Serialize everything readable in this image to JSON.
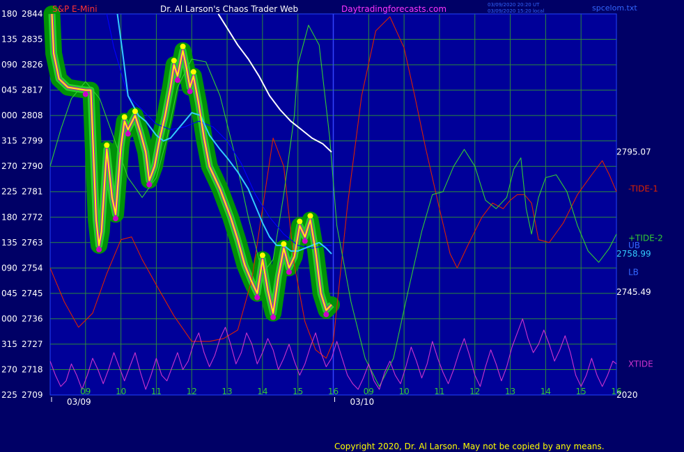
{
  "header": {
    "instrument": "S&P E-Mini",
    "site": "Dr. Al Larson's Chaos Trader Web",
    "url": "Daytradingforecasts.com",
    "timestamp_ut": "03/09/2020 20:20 UT",
    "timestamp_local": "03/09/2020 15:20 local",
    "file": "spcelom.txt"
  },
  "copyright": "Copyright 2020, Dr. Al Larson. May not be copied by any means.",
  "colors": {
    "background": "#000066",
    "plot_background": "#000099",
    "grid": "#2d8a3c",
    "price": "#ffff00",
    "cyan": "#33ccff",
    "tide1": "#dd2200",
    "tide2": "#33cc33",
    "xtide": "#cc33cc",
    "white_line": "#ffffff",
    "dark_blue_line": "#0000ff",
    "band_green": "#009900",
    "band_magenta": "#cc00cc"
  },
  "chart_data": {
    "type": "line",
    "title": "S&P E-Mini",
    "ylim": [
      2709,
      2844
    ],
    "xlim": [
      8.0,
      24.0
    ],
    "y_ticks": [
      {
        "angle": "180",
        "price": "2844"
      },
      {
        "angle": "135",
        "price": "2835"
      },
      {
        "angle": "090",
        "price": "2826"
      },
      {
        "angle": "045",
        "price": "2817"
      },
      {
        "angle": "000",
        "price": "2808"
      },
      {
        "angle": "315",
        "price": "2799"
      },
      {
        "angle": "270",
        "price": "2790"
      },
      {
        "angle": "225",
        "price": "2781"
      },
      {
        "angle": "180",
        "price": "2772"
      },
      {
        "angle": "135",
        "price": "2763"
      },
      {
        "angle": "090",
        "price": "2754"
      },
      {
        "angle": "045",
        "price": "2745"
      },
      {
        "angle": "000",
        "price": "2736"
      },
      {
        "angle": "315",
        "price": "2727"
      },
      {
        "angle": "270",
        "price": "2718"
      },
      {
        "angle": "225",
        "price": "2709"
      }
    ],
    "x_ticks": [
      {
        "x": 9,
        "label": "09"
      },
      {
        "x": 10,
        "label": "10"
      },
      {
        "x": 11,
        "label": "11"
      },
      {
        "x": 12,
        "label": "12"
      },
      {
        "x": 13,
        "label": "13"
      },
      {
        "x": 14,
        "label": "14"
      },
      {
        "x": 15,
        "label": "15"
      },
      {
        "x": 16,
        "label": "16"
      },
      {
        "x": 17,
        "label": "09"
      },
      {
        "x": 18,
        "label": "10"
      },
      {
        "x": 19,
        "label": "11"
      },
      {
        "x": 20,
        "label": "12"
      },
      {
        "x": 21,
        "label": "13"
      },
      {
        "x": 22,
        "label": "14"
      },
      {
        "x": 23,
        "label": "15"
      },
      {
        "x": 24,
        "label": "16"
      }
    ],
    "dates": [
      {
        "x": 8.0,
        "label": "03/09"
      },
      {
        "x": 16.0,
        "label": "03/10"
      }
    ],
    "day_divider_x": 16.0,
    "right_labels": [
      {
        "text": "2795.07",
        "y": 2795.07,
        "color": "#ffffff"
      },
      {
        "text": "-TIDE-1",
        "y": 2782.0,
        "color": "#dd2200"
      },
      {
        "text": "+TIDE-2",
        "y": 2764.5,
        "color": "#33cc33"
      },
      {
        "text": "UB",
        "y": 2762.0,
        "color": "#3366ff"
      },
      {
        "text": "2758.99",
        "y": 2758.99,
        "color": "#33ccff"
      },
      {
        "text": "LB",
        "y": 2752.5,
        "color": "#3366ff"
      },
      {
        "text": "2745.49",
        "y": 2745.49,
        "color": "#ffffff"
      },
      {
        "text": "XTIDE",
        "y": 2720.0,
        "color": "#cc33cc"
      },
      {
        "text": "2020",
        "y": 2709.0,
        "color": "#ffffff"
      }
    ],
    "series": [
      {
        "key": "price_yellow",
        "color": "#ffff00",
        "x": [
          8.05,
          8.1,
          8.25,
          8.5,
          8.75,
          9.0,
          9.15,
          9.3,
          9.38,
          9.45,
          9.6,
          9.75,
          9.85,
          10.0,
          10.1,
          10.2,
          10.4,
          10.55,
          10.7,
          10.8,
          10.95,
          11.1,
          11.25,
          11.4,
          11.5,
          11.6,
          11.75,
          11.85,
          11.95,
          12.05,
          12.2,
          12.35,
          12.5,
          12.65,
          12.8,
          12.95,
          13.1,
          13.3,
          13.5,
          13.7,
          13.85,
          14.0,
          14.15,
          14.3,
          14.45,
          14.6,
          14.75,
          14.9,
          15.05,
          15.2,
          15.35,
          15.5,
          15.65,
          15.8,
          15.95
        ],
        "y": [
          2844.0,
          2830.0,
          2821.0,
          2818.0,
          2817.5,
          2817.0,
          2817.0,
          2771.0,
          2762.0,
          2767.0,
          2796.0,
          2779.0,
          2773.0,
          2797.0,
          2806.0,
          2803.0,
          2808.0,
          2802.0,
          2795.0,
          2785.0,
          2790.0,
          2800.0,
          2808.0,
          2818.0,
          2826.0,
          2822.0,
          2831.0,
          2825.0,
          2818.0,
          2822.0,
          2812.0,
          2800.0,
          2790.0,
          2786.0,
          2782.0,
          2777.0,
          2772.0,
          2764.0,
          2755.0,
          2749.0,
          2745.0,
          2757.0,
          2746.0,
          2738.0,
          2751.0,
          2761.0,
          2754.0,
          2758.0,
          2769.0,
          2765.0,
          2771.0,
          2760.0,
          2745.0,
          2739.0,
          2741.0
        ]
      },
      {
        "key": "cyan_line",
        "color": "#33ccff",
        "x": [
          9.9,
          10.05,
          10.2,
          10.5,
          10.7,
          11.0,
          11.2,
          11.4,
          11.6,
          11.8,
          12.0,
          12.25,
          12.5,
          12.8,
          13.0,
          13.3,
          13.6,
          13.8,
          14.0,
          14.2,
          14.4,
          14.6,
          14.8,
          15.0,
          15.2,
          15.4,
          15.6,
          15.8,
          15.95
        ],
        "y": [
          2844.0,
          2830.0,
          2815.0,
          2808.0,
          2806.0,
          2801.0,
          2799.0,
          2800.0,
          2803.0,
          2806.0,
          2809.0,
          2808.0,
          2801.0,
          2796.0,
          2793.0,
          2788.0,
          2782.0,
          2776.0,
          2770.0,
          2765.0,
          2762.0,
          2762.0,
          2760.0,
          2760.0,
          2761.0,
          2762.0,
          2763.0,
          2761.0,
          2758.99
        ]
      },
      {
        "key": "dark_blue_line",
        "color": "#0000ff",
        "x": [
          9.6,
          9.8,
          10.2,
          10.6,
          11.0,
          11.4,
          11.8,
          12.2,
          12.6,
          13.0,
          13.4,
          13.8,
          14.2,
          14.6,
          15.0,
          15.4,
          15.8,
          15.95
        ],
        "y": [
          2844.0,
          2832.0,
          2815.0,
          2810.0,
          2805.0,
          2803.0,
          2804.0,
          2806.0,
          2804.0,
          2799.0,
          2791.0,
          2780.0,
          2772.0,
          2766.0,
          2762.0,
          2761.0,
          2762.0,
          2762.0
        ]
      },
      {
        "key": "white_line",
        "color": "#ffffff",
        "x": [
          12.75,
          13.0,
          13.3,
          13.6,
          13.9,
          14.2,
          14.5,
          14.8,
          15.1,
          15.4,
          15.7,
          15.95
        ],
        "y": [
          2844.0,
          2839.0,
          2833.0,
          2828.0,
          2822.0,
          2815.0,
          2810.0,
          2806.0,
          2803.0,
          2800.0,
          2798.0,
          2795.07
        ]
      },
      {
        "key": "tide1",
        "color": "#dd2200",
        "x": [
          8.0,
          8.4,
          8.8,
          9.2,
          9.6,
          10.0,
          10.3,
          10.6,
          11.0,
          11.5,
          12.0,
          12.5,
          12.9,
          13.3,
          13.7,
          14.0,
          14.3,
          14.6,
          14.9,
          15.2,
          15.5,
          15.8,
          16.0,
          16.4,
          16.8,
          17.2,
          17.6,
          18.0,
          18.3,
          18.6,
          19.0,
          19.3,
          19.5,
          19.8,
          20.2,
          20.5,
          20.8,
          21.0,
          21.2,
          21.4,
          21.6,
          21.8,
          22.1,
          22.5,
          22.9,
          23.3,
          23.6,
          23.8,
          24.0
        ],
        "y": [
          2754.0,
          2742.0,
          2733.0,
          2738.0,
          2752.0,
          2764.0,
          2765.0,
          2757.0,
          2748.0,
          2737.0,
          2728.0,
          2728.0,
          2729.0,
          2732.0,
          2750.0,
          2775.0,
          2800.0,
          2790.0,
          2755.0,
          2735.0,
          2725.0,
          2722.0,
          2728.0,
          2776.0,
          2815.0,
          2838.0,
          2843.0,
          2832.0,
          2815.0,
          2797.0,
          2775.0,
          2759.0,
          2754.0,
          2762.0,
          2772.0,
          2777.0,
          2775.0,
          2778.0,
          2780.0,
          2780.0,
          2777.0,
          2764.0,
          2763.0,
          2770.0,
          2780.0,
          2787.0,
          2792.0,
          2787.0,
          2781.0
        ]
      },
      {
        "key": "tide2",
        "color": "#33cc33",
        "x": [
          8.0,
          8.3,
          8.6,
          9.0,
          9.4,
          9.8,
          10.2,
          10.6,
          11.0,
          11.3,
          11.6,
          12.0,
          12.4,
          12.8,
          13.2,
          13.6,
          14.0,
          14.3,
          14.6,
          14.9,
          15.0,
          15.3,
          15.6,
          15.9,
          16.1,
          16.5,
          16.9,
          17.3,
          17.7,
          18.1,
          18.5,
          18.8,
          19.1,
          19.4,
          19.7,
          20.0,
          20.3,
          20.6,
          20.9,
          21.1,
          21.3,
          21.45,
          21.6,
          21.8,
          22.0,
          22.3,
          22.6,
          22.9,
          23.2,
          23.5,
          23.8,
          24.0
        ],
        "y": [
          2790.0,
          2803.0,
          2814.0,
          2820.0,
          2814.0,
          2800.0,
          2786.0,
          2779.0,
          2786.0,
          2800.0,
          2818.0,
          2828.0,
          2827.0,
          2815.0,
          2795.0,
          2772.0,
          2752.0,
          2757.0,
          2780.0,
          2808.0,
          2826.0,
          2840.0,
          2833.0,
          2800.0,
          2769.0,
          2742.0,
          2722.0,
          2712.0,
          2722.0,
          2745.0,
          2767.0,
          2780.0,
          2781.0,
          2790.0,
          2796.0,
          2790.0,
          2778.0,
          2775.0,
          2779.0,
          2789.0,
          2793.0,
          2775.0,
          2766.0,
          2779.0,
          2786.0,
          2787.0,
          2781.0,
          2769.0,
          2760.0,
          2756.0,
          2761.0,
          2766.0
        ]
      },
      {
        "key": "xtide",
        "color": "#cc33cc",
        "x": [
          8.0,
          8.15,
          8.3,
          8.45,
          8.6,
          8.75,
          8.9,
          9.05,
          9.2,
          9.35,
          9.5,
          9.65,
          9.8,
          9.95,
          10.1,
          10.25,
          10.4,
          10.55,
          10.7,
          10.85,
          11.0,
          11.15,
          11.3,
          11.45,
          11.6,
          11.75,
          11.9,
          12.05,
          12.2,
          12.35,
          12.5,
          12.65,
          12.8,
          12.95,
          13.1,
          13.25,
          13.4,
          13.55,
          13.7,
          13.85,
          14.0,
          14.15,
          14.3,
          14.45,
          14.6,
          14.75,
          14.9,
          15.05,
          15.2,
          15.35,
          15.5,
          15.65,
          15.8,
          15.95,
          16.1,
          16.25,
          16.4,
          16.55,
          16.7,
          16.85,
          17.0,
          17.15,
          17.3,
          17.45,
          17.6,
          17.75,
          17.9,
          18.05,
          18.2,
          18.35,
          18.5,
          18.65,
          18.8,
          18.95,
          19.1,
          19.25,
          19.4,
          19.55,
          19.7,
          19.85,
          20.0,
          20.15,
          20.3,
          20.45,
          20.6,
          20.75,
          20.9,
          21.05,
          21.2,
          21.35,
          21.5,
          21.65,
          21.8,
          21.95,
          22.1,
          22.25,
          22.4,
          22.55,
          22.7,
          22.85,
          23.0,
          23.15,
          23.3,
          23.45,
          23.6,
          23.75,
          23.9,
          24.0
        ],
        "y": [
          2721.0,
          2716.0,
          2712.0,
          2714.0,
          2720.0,
          2716.0,
          2711.0,
          2716.0,
          2722.0,
          2718.0,
          2713.0,
          2718.0,
          2724.0,
          2719.0,
          2714.0,
          2719.0,
          2724.0,
          2717.0,
          2711.0,
          2716.0,
          2722.0,
          2716.0,
          2714.0,
          2719.0,
          2724.0,
          2718.0,
          2721.0,
          2727.0,
          2731.0,
          2724.0,
          2719.0,
          2723.0,
          2729.0,
          2733.0,
          2727.0,
          2720.0,
          2724.0,
          2731.0,
          2727.0,
          2720.0,
          2724.0,
          2729.0,
          2725.0,
          2718.0,
          2722.0,
          2727.0,
          2721.0,
          2716.0,
          2720.0,
          2726.0,
          2731.0,
          2724.0,
          2719.0,
          2722.0,
          2728.0,
          2722.0,
          2716.0,
          2713.0,
          2711.0,
          2715.0,
          2720.0,
          2714.0,
          2711.0,
          2717.0,
          2721.0,
          2716.0,
          2713.0,
          2719.0,
          2726.0,
          2721.0,
          2715.0,
          2720.0,
          2728.0,
          2722.0,
          2717.0,
          2713.0,
          2718.0,
          2724.0,
          2729.0,
          2723.0,
          2716.0,
          2712.0,
          2719.0,
          2725.0,
          2720.0,
          2714.0,
          2719.0,
          2726.0,
          2731.0,
          2736.0,
          2729.0,
          2724.0,
          2727.0,
          2732.0,
          2727.0,
          2721.0,
          2725.0,
          2730.0,
          2724.0,
          2716.0,
          2712.0,
          2716.0,
          2722.0,
          2716.0,
          2712.0,
          2716.0,
          2721.0,
          2720.0
        ]
      }
    ]
  }
}
